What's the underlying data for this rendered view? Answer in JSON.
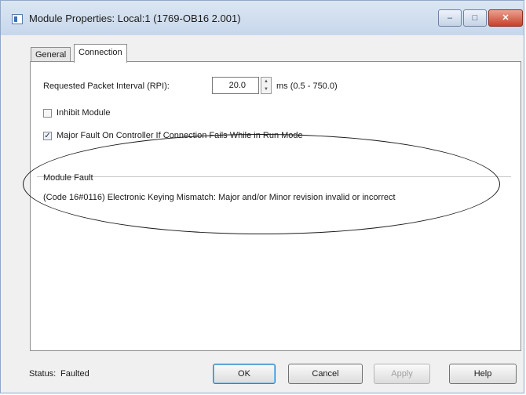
{
  "window": {
    "title": "Module Properties: Local:1 (1769-OB16 2.001)"
  },
  "title_controls": {
    "minimize": "–",
    "maximize": "□",
    "close": "✕"
  },
  "tabs": [
    {
      "label": "General"
    },
    {
      "label": "Connection"
    }
  ],
  "connection": {
    "rpi_label": "Requested Packet Interval (RPI):",
    "rpi_value": "20.0",
    "rpi_units": "ms (0.5 - 750.0)",
    "inhibit_label": "Inhibit Module",
    "inhibit_checked": false,
    "major_fault_label": "Major Fault On Controller If Connection Fails While in Run Mode",
    "major_fault_checked": true,
    "module_fault_label": "Module Fault",
    "module_fault_text": "(Code 16#0116) Electronic Keying Mismatch: Major and/or Minor revision invalid or incorrect"
  },
  "status": {
    "label": "Status:",
    "value": "Faulted"
  },
  "buttons": {
    "ok": "OK",
    "cancel": "Cancel",
    "apply": "Apply",
    "help": "Help"
  },
  "icons": {
    "app": "module-properties-icon",
    "spin_up": "▲",
    "spin_down": "▼",
    "check": "✓"
  }
}
